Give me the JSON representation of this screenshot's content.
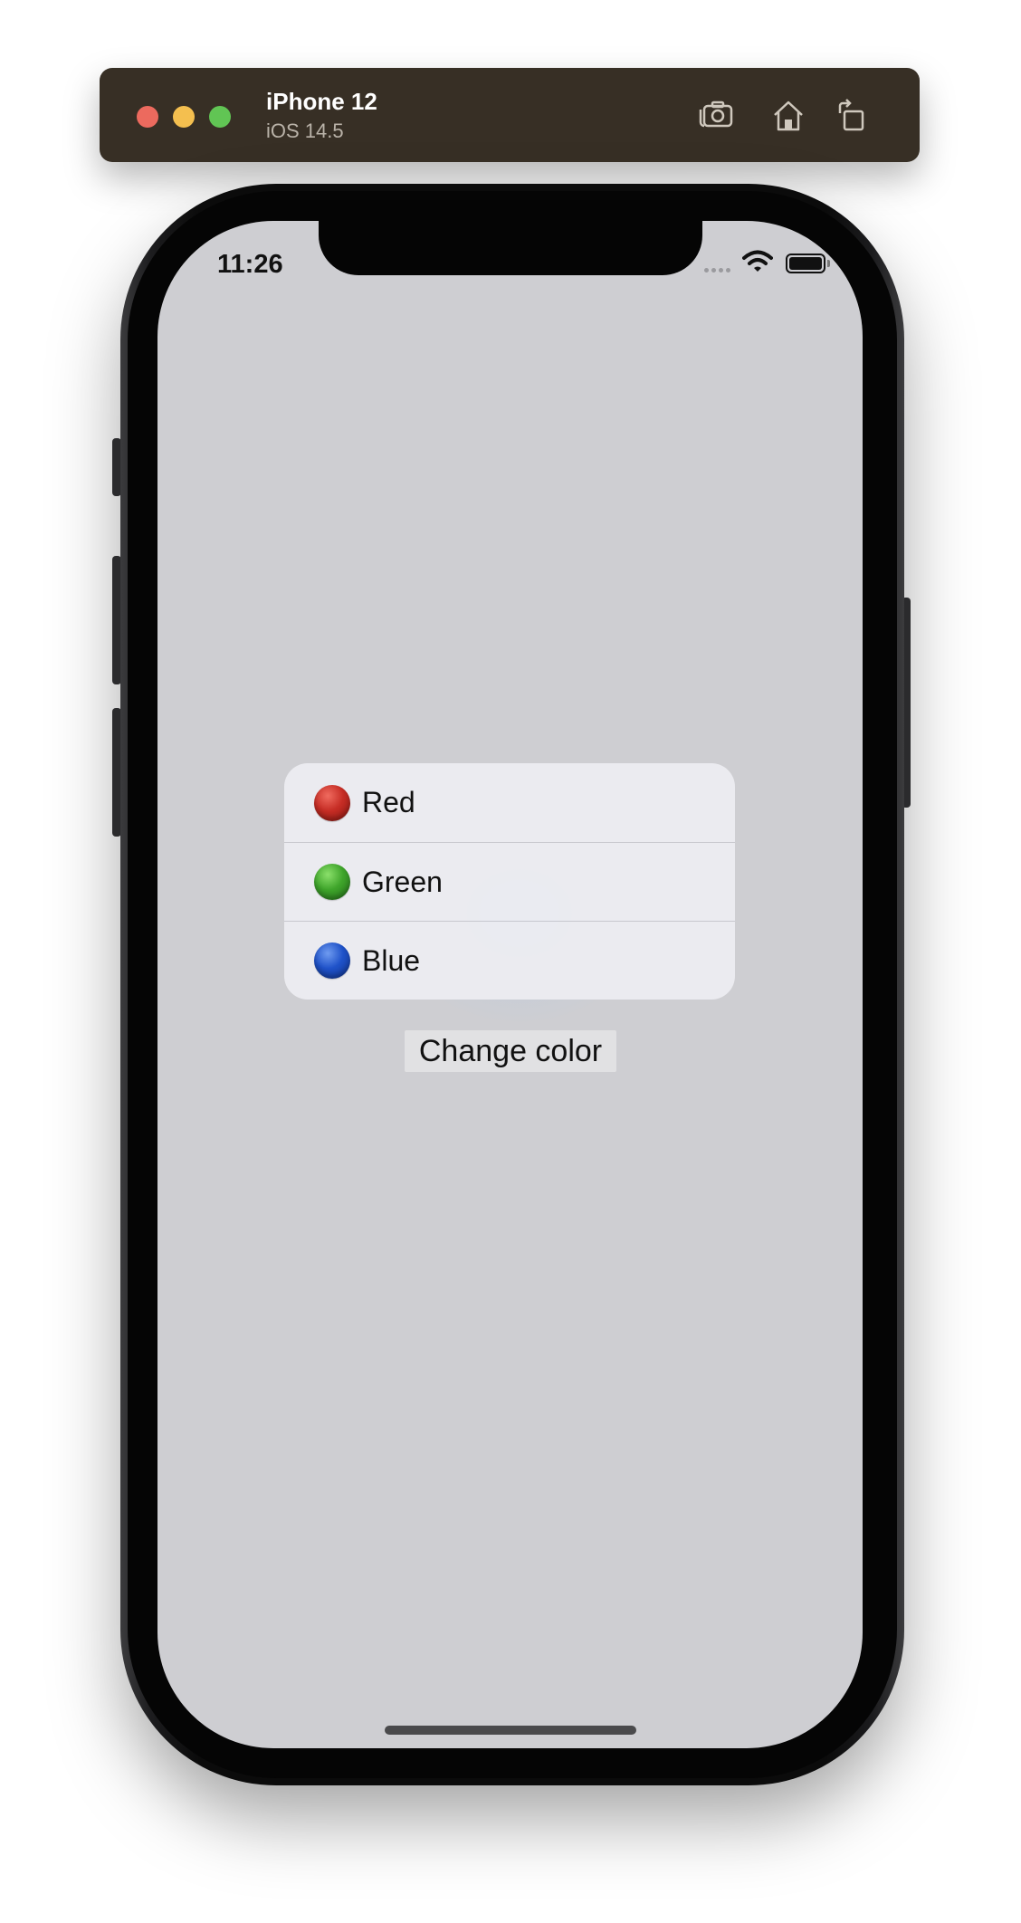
{
  "simulator": {
    "device_name": "iPhone 12",
    "os_version": "iOS 14.5",
    "toolbar": {
      "screenshot_icon": "camera-icon",
      "home_icon": "home-icon",
      "rotate_icon": "rotate-icon"
    },
    "window_controls": [
      "close",
      "minimize",
      "zoom"
    ],
    "colors": {
      "bar": "#372f25",
      "close": "#ec6a5e",
      "minimize": "#f4bf4f",
      "zoom": "#61c554"
    }
  },
  "status_bar": {
    "time": "11:26",
    "wifi_icon": "wifi-icon",
    "battery_icon": "battery-icon"
  },
  "menu": {
    "items": [
      {
        "label": "Red",
        "color": "#c62d25"
      },
      {
        "label": "Green",
        "color": "#3fa52b"
      },
      {
        "label": "Blue",
        "color": "#1f52c9"
      }
    ]
  },
  "main": {
    "button_label": "Change color"
  }
}
